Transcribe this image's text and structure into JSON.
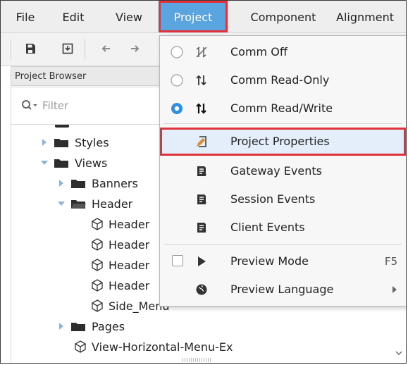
{
  "menubar": {
    "items": [
      "File",
      "Edit",
      "View",
      "Project",
      "Component",
      "Alignment"
    ]
  },
  "project_browser": {
    "title": "Project Browser",
    "filter_placeholder": "Filter",
    "tree": [
      {
        "label": "Styles",
        "type": "folder",
        "expanded": false
      },
      {
        "label": "Views",
        "type": "folder",
        "expanded": true
      },
      {
        "label": "Banners",
        "type": "folder",
        "expanded": false
      },
      {
        "label": "Header",
        "type": "folder",
        "expanded": true
      },
      {
        "label": "Header",
        "type": "view"
      },
      {
        "label": "Header",
        "type": "view"
      },
      {
        "label": "Header",
        "type": "view"
      },
      {
        "label": "Header",
        "type": "view"
      },
      {
        "label": "Side_Menu",
        "type": "view"
      },
      {
        "label": "Pages",
        "type": "folder",
        "expanded": false
      },
      {
        "label": "View-Horizontal-Menu-Ex",
        "type": "view"
      }
    ]
  },
  "project_menu": {
    "comm_off": "Comm Off",
    "comm_read_only": "Comm Read-Only",
    "comm_read_write": "Comm Read/Write",
    "selected_comm": "Comm Read/Write",
    "project_properties": "Project Properties",
    "gateway_events": "Gateway Events",
    "session_events": "Session Events",
    "client_events": "Client Events",
    "preview_mode": "Preview Mode",
    "preview_mode_shortcut": "F5",
    "preview_language": "Preview Language"
  },
  "colors": {
    "active_menu": "#5aa4e0",
    "highlight_outline": "#e0323a",
    "radio_selected": "#2f8fe0",
    "edit_icon_accent": "#e08a2c"
  },
  "icons": {
    "save": "save-icon",
    "import": "import-icon",
    "undo": "undo-icon",
    "redo": "redo-icon",
    "filter": "search-icon",
    "folder": "folder-icon",
    "view": "view-cube-icon"
  }
}
